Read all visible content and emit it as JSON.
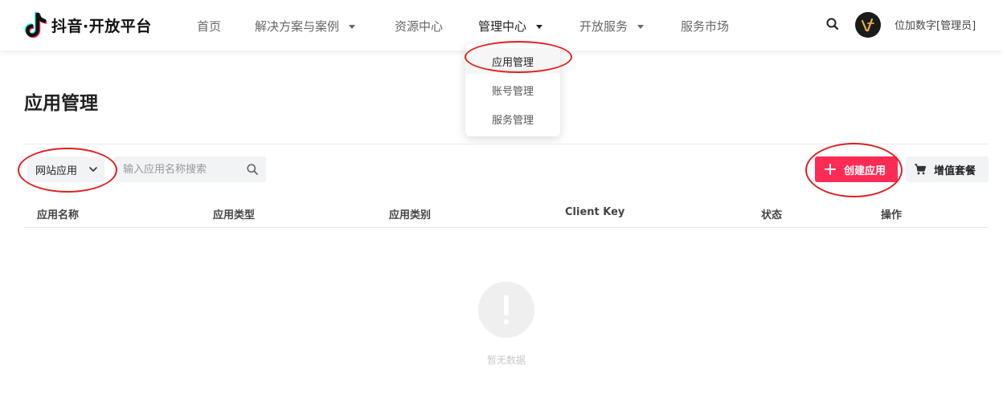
{
  "brand": {
    "name": "抖音·开放平台",
    "accent": "#fe2c55"
  },
  "nav": {
    "items": [
      {
        "label": "首页",
        "has_caret": false
      },
      {
        "label": "解决方案与案例",
        "has_caret": true
      },
      {
        "label": "资源中心",
        "has_caret": false
      },
      {
        "label": "管理中心",
        "has_caret": true,
        "active": true
      },
      {
        "label": "开放服务",
        "has_caret": true
      },
      {
        "label": "服务市场",
        "has_caret": false
      }
    ],
    "search_icon": "search-icon",
    "username": "位加数字[管理员]"
  },
  "dropdown": {
    "items": [
      {
        "label": "应用管理",
        "selected": true
      },
      {
        "label": "账号管理",
        "selected": false
      },
      {
        "label": "服务管理",
        "selected": false
      }
    ]
  },
  "page": {
    "title": "应用管理"
  },
  "toolbar": {
    "type_select_value": "网站应用",
    "search_placeholder": "输入应用名称搜索",
    "create_label": "创建应用",
    "vas_label": "增值套餐"
  },
  "table": {
    "columns": [
      "应用名称",
      "应用类型",
      "应用类别",
      "Client Key",
      "状态",
      "操作"
    ],
    "rows": []
  },
  "empty": {
    "text": "暂无数据"
  }
}
